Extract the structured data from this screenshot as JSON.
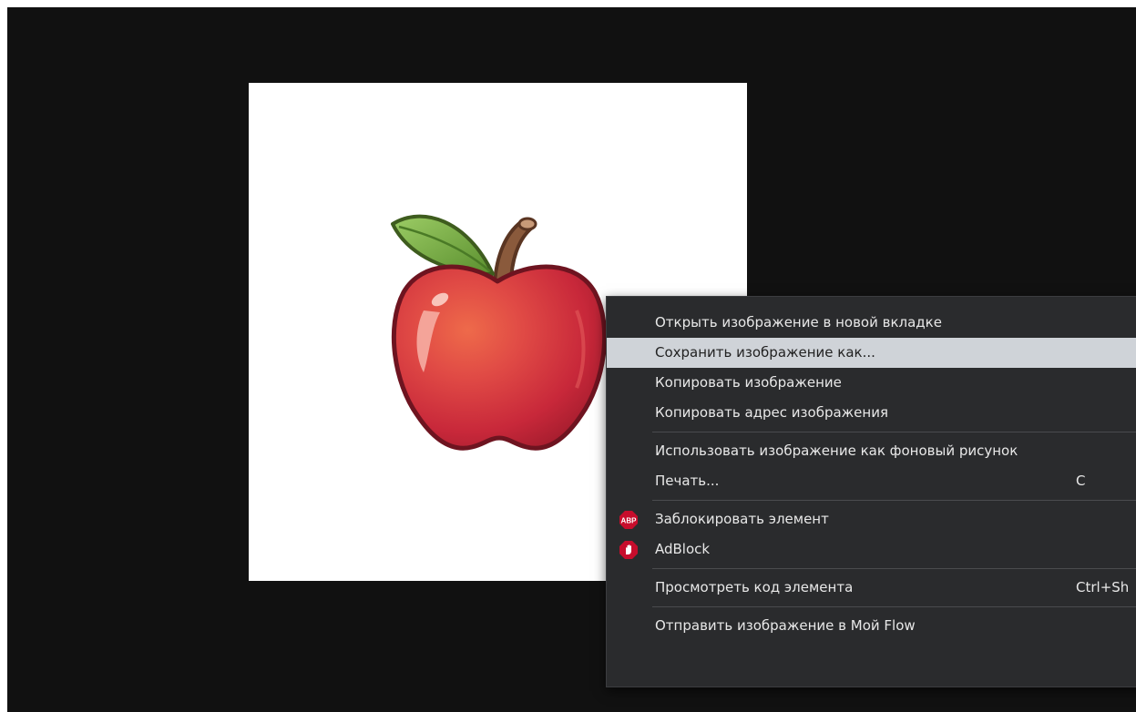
{
  "context_menu": {
    "items": [
      {
        "label": "Открыть изображение в новой вкладке"
      },
      {
        "label": "Сохранить изображение как..."
      },
      {
        "label": "Копировать изображение"
      },
      {
        "label": "Копировать адрес изображения"
      },
      {
        "label": "Использовать изображение как фоновый рисунок"
      },
      {
        "label": "Печать...",
        "shortcut": "C"
      },
      {
        "label": "Заблокировать элемент",
        "icon": "adblock-plus-icon",
        "icon_text": "ABP"
      },
      {
        "label": "AdBlock",
        "icon": "adblock-hand-icon"
      },
      {
        "label": "Просмотреть код элемента",
        "shortcut": "Ctrl+Sh"
      },
      {
        "label": "Отправить изображение в Мой Flow"
      }
    ],
    "highlighted_item": "Сохранить изображение как...",
    "colors": {
      "background": "#2a2b2d",
      "highlight": "#cfd3d8",
      "abp_red": "#c70d2c"
    }
  },
  "image": {
    "subject": "apple-illustration",
    "colors": {
      "apple_body": "#c8283a",
      "leaf": "#7cb342",
      "stem": "#8a5a3c"
    }
  }
}
